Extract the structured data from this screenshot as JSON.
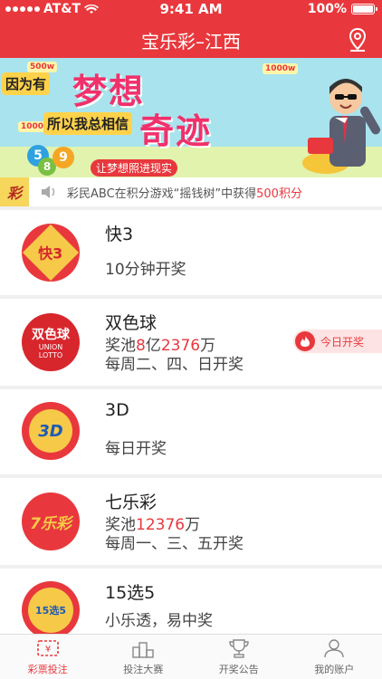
{
  "status_bar": {
    "carrier": "AT&T",
    "time": "9:41 AM",
    "battery": "100%"
  },
  "nav": {
    "title": "宝乐彩–江西",
    "location_icon": "location-pin-icon"
  },
  "banner": {
    "line1": "因为有",
    "dream": "梦想",
    "line2": "所以我总相信",
    "miracle": "奇迹",
    "subtitle": "让梦想照进现实",
    "tag_500w": "500w",
    "tag_1000w_a": "1000w",
    "tag_1000w_b": "1000w",
    "balls": [
      "5",
      "8",
      "9"
    ]
  },
  "notice": {
    "badge": "彩",
    "prefix": "彩民ABC在积分游戏“摇钱树”中获得",
    "highlight": "500积分"
  },
  "lotteries": [
    {
      "name": "快3",
      "logo_text": "快3",
      "line1_prefix": "10分钟开奖",
      "line1_highlight": "",
      "line1_suffix": "",
      "line2": ""
    },
    {
      "name": "双色球",
      "logo_text": "双色球",
      "logo_sub": "UNION LOTTO",
      "line1_prefix": "奖池",
      "line1_highlight": "8",
      "line1_mid": "亿",
      "line1_highlight2": "2376",
      "line1_suffix": "万",
      "line2": "每周二、四、日开奖",
      "badge": "今日开奖"
    },
    {
      "name": "3D",
      "logo_text": "3D",
      "line1_prefix": "每日开奖",
      "line2": ""
    },
    {
      "name": "七乐彩",
      "logo_text": "7乐彩",
      "line1_prefix": "奖池",
      "line1_highlight": "12376",
      "line1_suffix": "万",
      "line2": "每周一、三、五开奖"
    },
    {
      "name": "15选5",
      "logo_text": "15选5",
      "line1_prefix": "小乐透，易中奖",
      "line2": ""
    }
  ],
  "tabs": [
    {
      "label": "彩票投注",
      "icon": "lottery-ticket-icon",
      "active": true
    },
    {
      "label": "投注大赛",
      "icon": "podium-icon",
      "active": false
    },
    {
      "label": "开奖公告",
      "icon": "trophy-icon",
      "active": false
    },
    {
      "label": "我的账户",
      "icon": "user-icon",
      "active": false
    }
  ],
  "colors": {
    "brand_red": "#e8383d",
    "banner_bg": "#a9e3ee",
    "notice_highlight": "#e8383d"
  }
}
